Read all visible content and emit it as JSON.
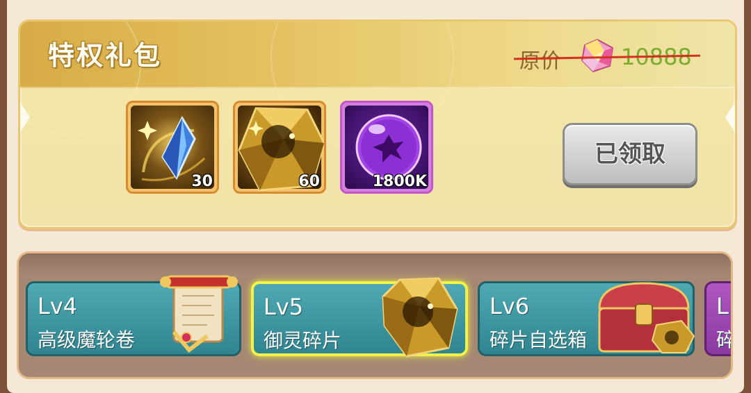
{
  "gift_pack": {
    "title": "特权礼包",
    "original_price_label": "原价",
    "original_price_value": "10888",
    "price_currency_icon": "gem-icon",
    "claim_button_label": "已领取",
    "items": [
      {
        "icon": "blue-crystal-icon",
        "quantity": "30"
      },
      {
        "icon": "gold-gem-icon",
        "quantity": "60"
      },
      {
        "icon": "purple-orb-icon",
        "quantity": "1800K"
      }
    ]
  },
  "level_rewards": [
    {
      "level": "Lv4",
      "name": "高级魔轮卷",
      "icon": "scroll-icon"
    },
    {
      "level": "Lv5",
      "name": "御灵碎片",
      "icon": "gold-gem-icon"
    },
    {
      "level": "Lv6",
      "name": "碎片自选箱",
      "icon": "treasure-chest-icon"
    },
    {
      "level": "L",
      "name": "碎",
      "icon": ""
    }
  ],
  "colors": {
    "strike": "#d23222",
    "price_value": "#7bab2f",
    "active_border": "#f2f24a",
    "level_card": "#3d97a1"
  }
}
